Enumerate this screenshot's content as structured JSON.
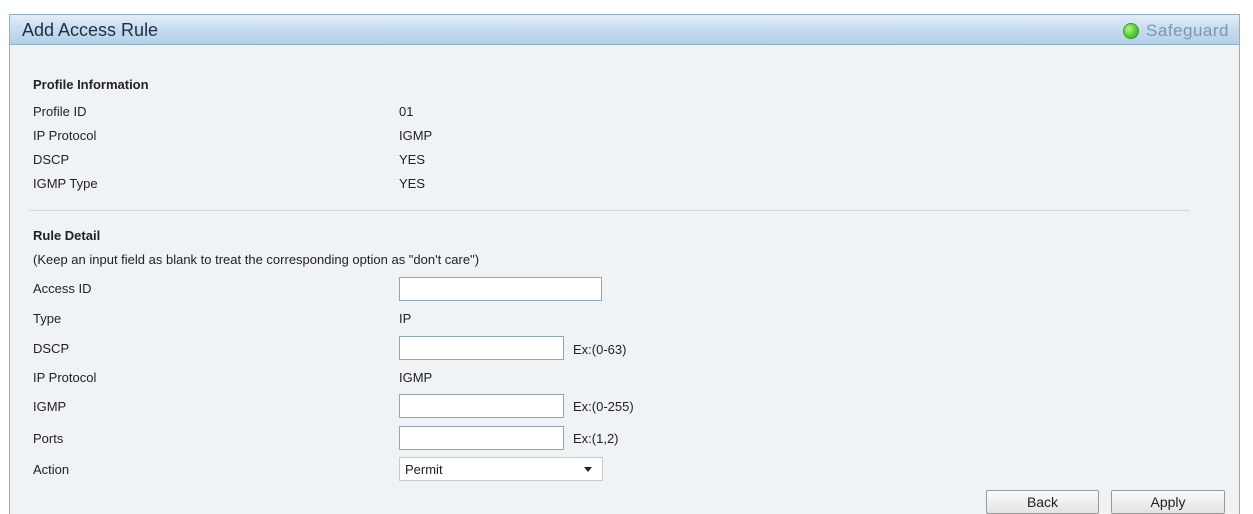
{
  "header": {
    "title": "Add Access Rule",
    "status_label": "Safeguard",
    "status_color": "#3fc22a",
    "status_icon": "status-led-icon"
  },
  "profile_info": {
    "heading": "Profile Information",
    "rows": [
      {
        "label": "Profile ID",
        "value": "01"
      },
      {
        "label": "IP Protocol",
        "value": "IGMP"
      },
      {
        "label": "DSCP",
        "value": "YES"
      },
      {
        "label": "IGMP Type",
        "value": "YES"
      }
    ]
  },
  "rule_detail": {
    "heading": "Rule Detail",
    "note": "(Keep an input field as blank to treat the corresponding option as \"don't care\")",
    "access_id": {
      "label": "Access ID",
      "value": ""
    },
    "type": {
      "label": "Type",
      "value": "IP"
    },
    "dscp": {
      "label": "DSCP",
      "value": "",
      "hint": "Ex:(0-63)"
    },
    "ip_protocol": {
      "label": "IP Protocol",
      "value": "IGMP"
    },
    "igmp": {
      "label": "IGMP",
      "value": "",
      "hint": "Ex:(0-255)"
    },
    "ports": {
      "label": "Ports",
      "value": "",
      "hint": "Ex:(1,2)"
    },
    "action": {
      "label": "Action",
      "selected": "Permit"
    }
  },
  "buttons": {
    "back": "Back",
    "apply": "Apply"
  }
}
